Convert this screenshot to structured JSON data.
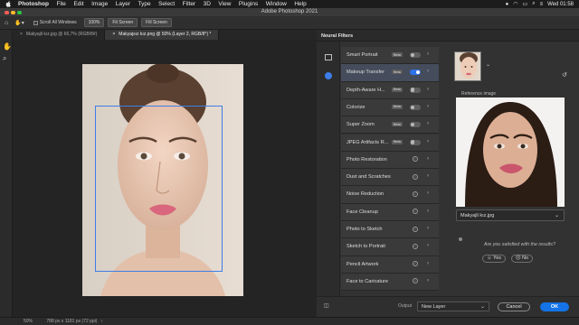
{
  "menubar": {
    "app_name": "Photoshop",
    "items": [
      "File",
      "Edit",
      "Image",
      "Layer",
      "Type",
      "Select",
      "Filter",
      "3D",
      "View",
      "Plugins",
      "Window",
      "Help"
    ],
    "clock": "Wed 01:58"
  },
  "window": {
    "title": "Adobe Photoshop 2021"
  },
  "options_bar": {
    "scroll_all_windows": "Scroll All Windows",
    "zoom": "100%",
    "fit_screen": "Fit Screen",
    "fill_screen": "Fill Screen"
  },
  "tabs": [
    {
      "label": "Makyajli kız.jpg @ 66,7% (RGB/8#)",
      "active": false
    },
    {
      "label": "Makyajsız kız.png @ 50% (Layer 2, RGB/8*) *",
      "active": true
    }
  ],
  "panel": {
    "title": "Neural Filters",
    "filters": [
      {
        "label": "Smart Portrait",
        "beta": "Beta",
        "control": "toggle",
        "on": false
      },
      {
        "label": "Makeup Transfer",
        "beta": "Beta",
        "control": "toggle",
        "on": true
      },
      {
        "label": "Depth-Aware H...",
        "beta": "Beta",
        "control": "toggle",
        "on": false
      },
      {
        "label": "Colorize",
        "beta": "Beta",
        "control": "toggle",
        "on": false
      },
      {
        "label": "Super Zoom",
        "beta": "Beta",
        "control": "toggle",
        "on": false
      },
      {
        "label": "JPEG Artifacts R...",
        "beta": "Beta",
        "control": "toggle",
        "on": false
      },
      {
        "label": "Photo Restoration",
        "control": "info"
      },
      {
        "label": "Dust and Scratches",
        "control": "info"
      },
      {
        "label": "Noise Reduction",
        "control": "info"
      },
      {
        "label": "Face Cleanup",
        "control": "info"
      },
      {
        "label": "Photo to Sketch",
        "control": "info"
      },
      {
        "label": "Sketch to Portrait",
        "control": "info"
      },
      {
        "label": "Pencil Artwork",
        "control": "info"
      },
      {
        "label": "Face to Caricature",
        "control": "info"
      }
    ],
    "reference_label": "Reference image",
    "reference_file": "Makyajli kız.jpg",
    "satisfied_question": "Are you satisfied with the results?",
    "yes": "Yes",
    "no": "No",
    "output_label": "Output",
    "output_value": "New Layer",
    "cancel": "Cancel",
    "ok": "OK"
  },
  "status": {
    "zoom": "50%",
    "doc_info": "788 px x 1181 px (72 ppi)"
  }
}
